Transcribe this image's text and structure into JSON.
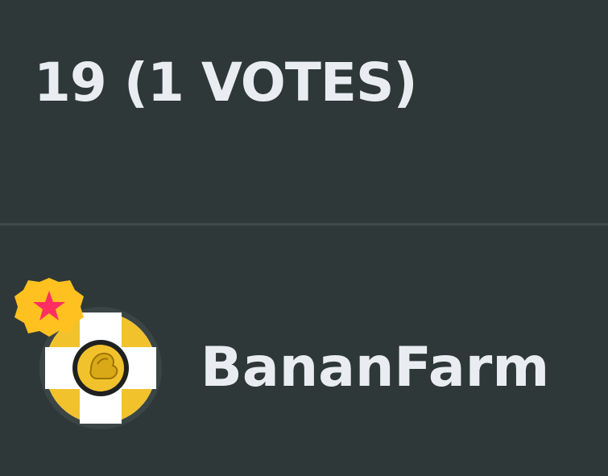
{
  "votes": {
    "text": "19 (1 VOTES)"
  },
  "user": {
    "name": "BananFarm",
    "avatar_icon": "yellow-cross-coin-avatar-icon",
    "badge_icon": "red-star-badge-icon"
  },
  "colors": {
    "background": "#2e3838",
    "divider": "#414b4b",
    "text": "#e9edf2",
    "avatar_yellow": "#f2c22d",
    "badge_star": "#ff2f62"
  }
}
